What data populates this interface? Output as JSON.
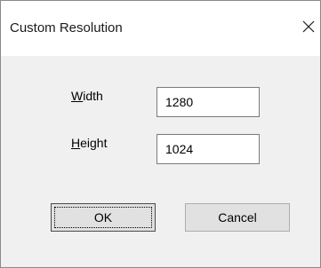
{
  "window": {
    "title": "Custom Resolution",
    "close_icon": "close-icon"
  },
  "form": {
    "width": {
      "label_accel": "W",
      "label_rest": "idth",
      "value": "1280"
    },
    "height": {
      "label_accel": "H",
      "label_rest": "eight",
      "value": "1024"
    }
  },
  "buttons": {
    "ok": "OK",
    "cancel": "Cancel"
  }
}
